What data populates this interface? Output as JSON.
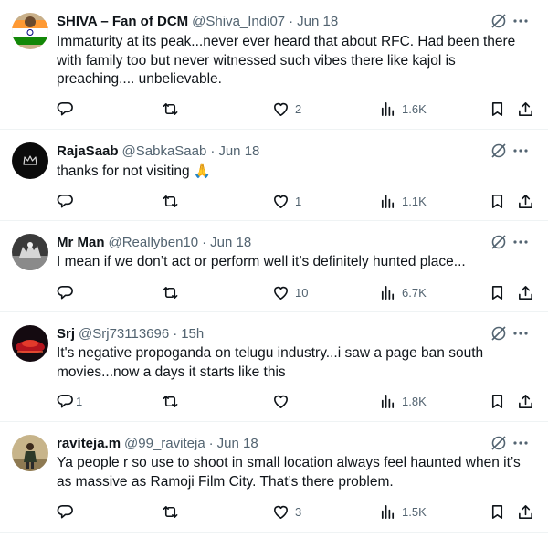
{
  "tweets": [
    {
      "name": "SHIVA – Fan of DCM",
      "handle": "@Shiva_Indi07",
      "time": "Jun 18",
      "text": "Immaturity at its peak...never ever heard that about RFC. Had been there with family too but never witnessed such vibes there like kajol is preaching.... unbelievable.",
      "replies": "",
      "likes": "2",
      "views": "1.6K",
      "avatar": "india-flag-avatar"
    },
    {
      "name": "RajaSaab",
      "handle": "@SabkaSaab",
      "time": "Jun 18",
      "text": "thanks for not visiting 🙏",
      "replies": "",
      "likes": "1",
      "views": "1.1K",
      "avatar": "crown-avatar"
    },
    {
      "name": "Mr Man",
      "handle": "@Reallyben10",
      "time": "Jun 18",
      "text": "I mean if we don’t act or perform well it’s definitely hunted place...",
      "replies": "",
      "likes": "10",
      "views": "6.7K",
      "avatar": "bw-photo-avatar"
    },
    {
      "name": "Srj",
      "handle": "@Srj73113696",
      "time": "15h",
      "text": "It's negative propoganda on telugu industry...i saw a page ban south movies...now a days it starts like this",
      "replies": "1",
      "likes": "",
      "views": "1.8K",
      "avatar": "red-car-avatar"
    },
    {
      "name": "raviteja.m",
      "handle": "@99_raviteja",
      "time": "Jun 18",
      "text": "Ya people r so use to shoot in small location always feel haunted when it’s as massive as Ramoji Film City. That’s there problem.",
      "replies": "",
      "likes": "3",
      "views": "1.5K",
      "avatar": "person-photo-avatar"
    }
  ],
  "colors": {
    "text": "#0f1419",
    "secondary": "#536471",
    "divider": "#eff3f4"
  }
}
